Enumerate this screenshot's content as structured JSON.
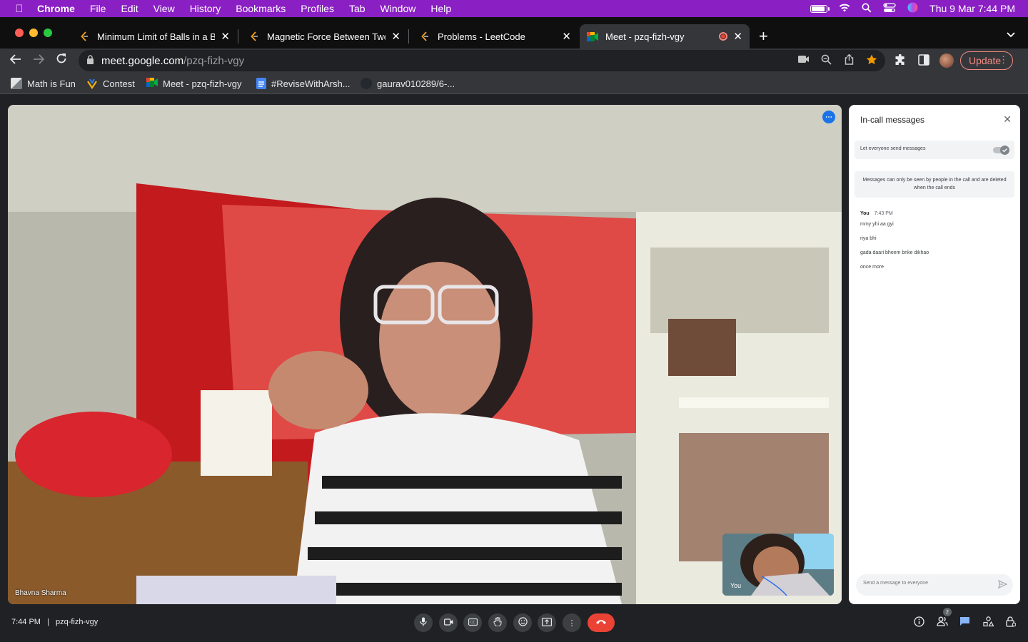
{
  "menubar": {
    "apple_icon": "apple-icon",
    "app_name": "Chrome",
    "items": [
      "File",
      "Edit",
      "View",
      "History",
      "Bookmarks",
      "Profiles",
      "Tab",
      "Window",
      "Help"
    ],
    "datetime": "Thu 9 Mar  7:44 PM",
    "battery_charge": 0.9
  },
  "tabs": [
    {
      "title": "Minimum Limit of Balls in a Bag",
      "favicon": "leetcode-icon"
    },
    {
      "title": "Magnetic Force Between Two Balls",
      "favicon": "leetcode-icon"
    },
    {
      "title": "Problems - LeetCode",
      "favicon": "leetcode-icon"
    },
    {
      "title": "Meet - pzq-fizh-vgy",
      "favicon": "meet-icon",
      "active": true
    }
  ],
  "toolbar": {
    "url_host": "meet.google.com",
    "url_path": "/pzq-fizh-vgy",
    "update_label": "Update"
  },
  "bookmarks": [
    {
      "label": "Math is Fun",
      "color": "#7a7f85"
    },
    {
      "label": "Contest",
      "color": "#f5b400"
    },
    {
      "label": "Meet - pzq-fizh-vgy",
      "color": "#00832d"
    },
    {
      "label": "#ReviseWithArsh...",
      "color": "#4285f4"
    },
    {
      "label": "gaurav010289/6-...",
      "color": "#24292f"
    }
  ],
  "meet": {
    "main_participant": "Bhavna Sharma",
    "self_label": "You",
    "time": "7:44 PM",
    "separator": "|",
    "meeting_code": "pzq-fizh-vgy",
    "people_count": "2"
  },
  "chat": {
    "title": "In-call messages",
    "toggle_label": "Let everyone send messages",
    "toggle_on": true,
    "info": "Messages can only be seen by people in the call and are deleted when the call ends",
    "sender": "You",
    "sent_time": "7:43 PM",
    "messages": [
      "mmy yhi aa gyi",
      "riya bhi",
      "gada daari bheem bnke dikhao",
      "once more"
    ],
    "input_placeholder": "Send a message to everyone"
  }
}
